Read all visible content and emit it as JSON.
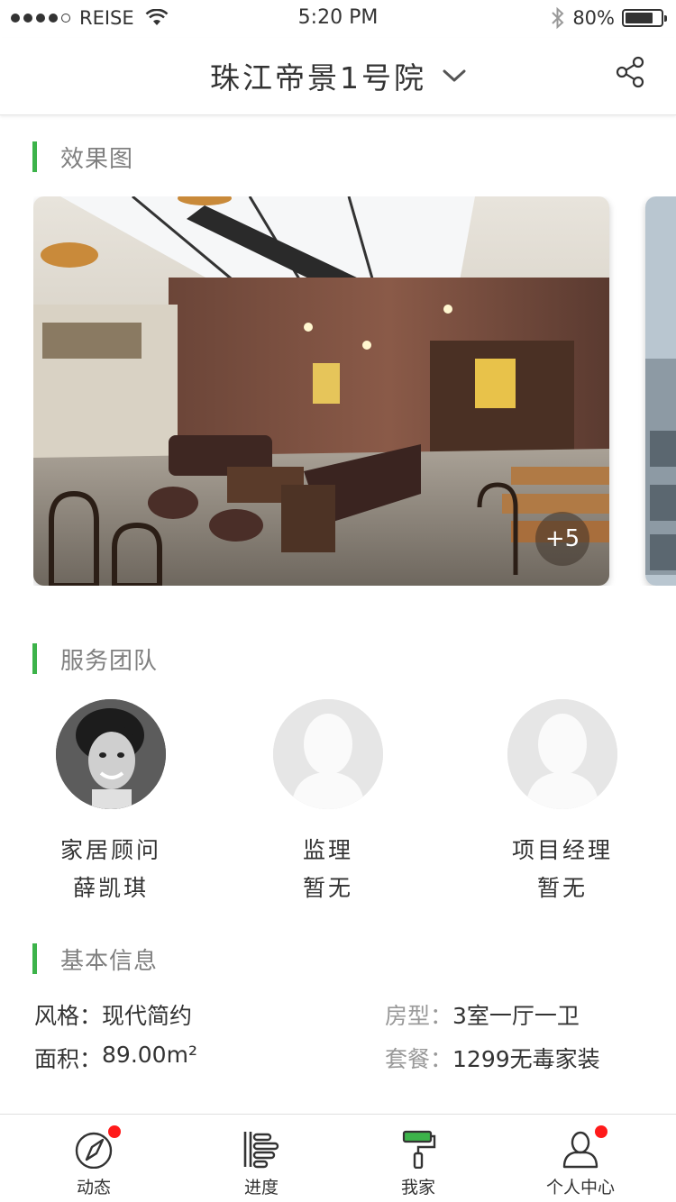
{
  "status_bar": {
    "carrier": "REISE",
    "time": "5:20 PM",
    "battery": "80%",
    "battery_level": 0.8
  },
  "header": {
    "title": "珠江帝景1号院"
  },
  "sections": {
    "effects": "效果图",
    "team": "服务团队",
    "basic": "基本信息"
  },
  "gallery": {
    "more_count": "+5"
  },
  "team": [
    {
      "role": "家居顾问",
      "name": "薛凯琪"
    },
    {
      "role": "监理",
      "name": "暂无"
    },
    {
      "role": "项目经理",
      "name": "暂无"
    }
  ],
  "info": {
    "style_label": "风格：",
    "style_value": "现代简约",
    "layout_label": "房型：",
    "layout_value": "3室一厅一卫",
    "area_label": "面积：",
    "area_value": "89.00m²",
    "package_label": "套餐：",
    "package_value": "1299无毒家装"
  },
  "tabs": [
    {
      "label": "动态",
      "icon": "compass-icon",
      "badge": true
    },
    {
      "label": "进度",
      "icon": "progress-icon",
      "badge": false
    },
    {
      "label": "我家",
      "icon": "paint-roller-icon",
      "badge": false
    },
    {
      "label": "个人中心",
      "icon": "user-icon",
      "badge": true
    }
  ],
  "colors": {
    "accent": "#3cb34a",
    "badge": "#ff1a1a"
  }
}
